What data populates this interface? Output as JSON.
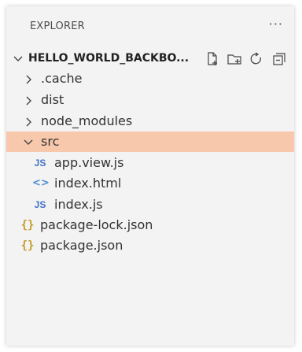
{
  "explorer": {
    "title": "EXPLORER",
    "more": "···",
    "workspace": {
      "name": "HELLO_WORLD_BACKBO...",
      "actions": [
        "new-file-icon",
        "new-folder-icon",
        "refresh-icon",
        "collapse-all-icon"
      ]
    },
    "tree": [
      {
        "label": ".cache",
        "type": "folder",
        "expanded": false
      },
      {
        "label": "dist",
        "type": "folder",
        "expanded": false
      },
      {
        "label": "node_modules",
        "type": "folder",
        "expanded": false
      },
      {
        "label": "src",
        "type": "folder",
        "expanded": true,
        "selected": true
      },
      {
        "label": "app.view.js",
        "type": "js",
        "icon_text": "JS"
      },
      {
        "label": "index.html",
        "type": "html",
        "icon_text": "<>"
      },
      {
        "label": "index.js",
        "type": "js",
        "icon_text": "JS"
      },
      {
        "label": "package-lock.json",
        "type": "json",
        "icon_text": "{}"
      },
      {
        "label": "package.json",
        "type": "json",
        "icon_text": "{}"
      }
    ]
  },
  "colors": {
    "background": "#f3f3f3",
    "selected": "#f7c8ab",
    "js_icon": "#4072c4",
    "json_icon": "#c59c28",
    "html_icon": "#4d8fd1"
  }
}
